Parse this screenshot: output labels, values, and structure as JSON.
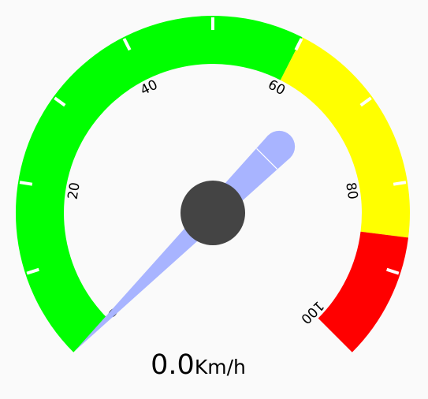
{
  "speedometer": {
    "speed_value": "0.0",
    "unit": "Km/h",
    "speed": 0,
    "min": 0,
    "max": 100,
    "tick_labels": [
      "0",
      "20",
      "40",
      "60",
      "80",
      "100"
    ],
    "color_bands": [
      {
        "name": "green-band",
        "from": 0,
        "to": 60,
        "color": "#00ff00"
      },
      {
        "name": "yellow-band",
        "from": 60,
        "to": 86,
        "color": "#ffff00"
      },
      {
        "name": "red-band",
        "from": 86,
        "to": 100,
        "color": "#ff0000"
      }
    ],
    "needle_color": "#a8b4ff",
    "hub_color": "#444444",
    "tick_color": "#ffffff"
  }
}
